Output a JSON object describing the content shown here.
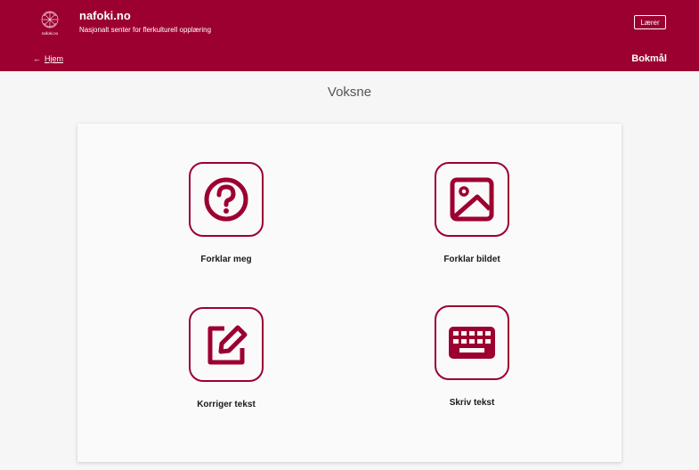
{
  "header": {
    "brand_name": "nafoki.no",
    "brand_subtitle": "Nasjonalt senter for flerkulturell opplæring",
    "logo_text": "nafoki.no",
    "role_button": "Lærer",
    "back_label": "Hjem",
    "language": "Bokmål"
  },
  "page": {
    "title": "Voksne"
  },
  "tiles": [
    {
      "label": "Forklar meg",
      "icon": "question-icon"
    },
    {
      "label": "Forklar bildet",
      "icon": "image-icon"
    },
    {
      "label": "Korriger tekst",
      "icon": "edit-icon"
    },
    {
      "label": "Skriv tekst",
      "icon": "keyboard-icon"
    }
  ],
  "colors": {
    "brand": "#9c0030",
    "background": "#f6f6f6"
  }
}
